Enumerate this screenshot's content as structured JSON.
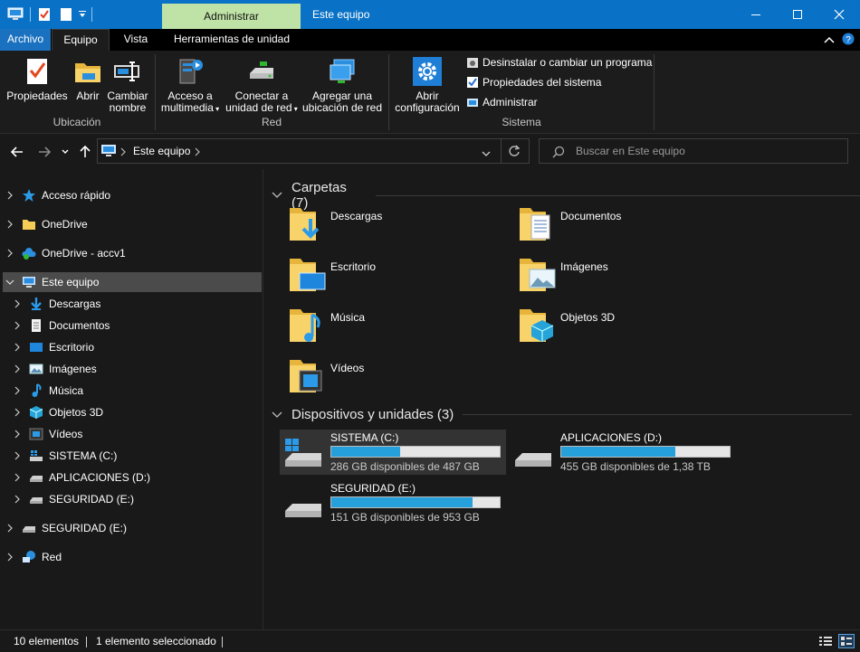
{
  "titlebar": {
    "context_tab": "Administrar",
    "title": "Este equipo"
  },
  "tabs": {
    "file": "Archivo",
    "home": "Equipo",
    "view": "Vista",
    "drive_tools": "Herramientas de unidad"
  },
  "ribbon": {
    "location": {
      "properties_label": "Propiedades",
      "open_label": "Abrir",
      "rename_label_1": "Cambiar",
      "rename_label_2": "nombre",
      "group_label": "Ubicación"
    },
    "network": {
      "media_label_1": "Acceso a",
      "media_label_2": "multimedia",
      "map_label_1": "Conectar a",
      "map_label_2": "unidad de red",
      "add_label_1": "Agregar una",
      "add_label_2": "ubicación de red",
      "group_label": "Red"
    },
    "system": {
      "settings_label_1": "Abrir",
      "settings_label_2": "configuración",
      "uninstall_label": "Desinstalar o cambiar un programa",
      "sysprops_label": "Propiedades del sistema",
      "manage_label": "Administrar",
      "group_label": "Sistema"
    }
  },
  "address": {
    "path": "Este equipo",
    "search_placeholder": "Buscar en Este equipo"
  },
  "navpane": {
    "quick_access": "Acceso rápido",
    "onedrive": "OneDrive",
    "onedrive_accv": "OneDrive - accv1",
    "this_pc": "Este equipo",
    "children": [
      "Descargas",
      "Documentos",
      "Escritorio",
      "Imágenes",
      "Música",
      "Objetos 3D",
      "Vídeos",
      "SISTEMA (C:)",
      "APLICACIONES (D:)",
      "SEGURIDAD (E:)"
    ],
    "usb": "SEGURIDAD (E:)",
    "network": "Red"
  },
  "content": {
    "folders_header": "Carpetas (7)",
    "folders": [
      "Descargas",
      "Documentos",
      "Escritorio",
      "Imágenes",
      "Música",
      "Objetos 3D",
      "Vídeos"
    ],
    "drives_header": "Dispositivos y unidades (3)",
    "drives": [
      {
        "name": "SISTEMA (C:)",
        "free": "286 GB disponibles de 487 GB",
        "used_fraction": 0.41
      },
      {
        "name": "APLICACIONES (D:)",
        "free": "455 GB disponibles de 1,38 TB",
        "used_fraction": 0.68
      },
      {
        "name": "SEGURIDAD (E:)",
        "free": "151 GB disponibles de 953 GB",
        "used_fraction": 0.84
      }
    ]
  },
  "statusbar": {
    "count": "10 elementos",
    "selected": "1 elemento seleccionado"
  },
  "colors": {
    "accent": "#0a72c6",
    "context_tab": "#bfe3a6",
    "drive_bar": "#26a0da",
    "background": "#191919"
  }
}
